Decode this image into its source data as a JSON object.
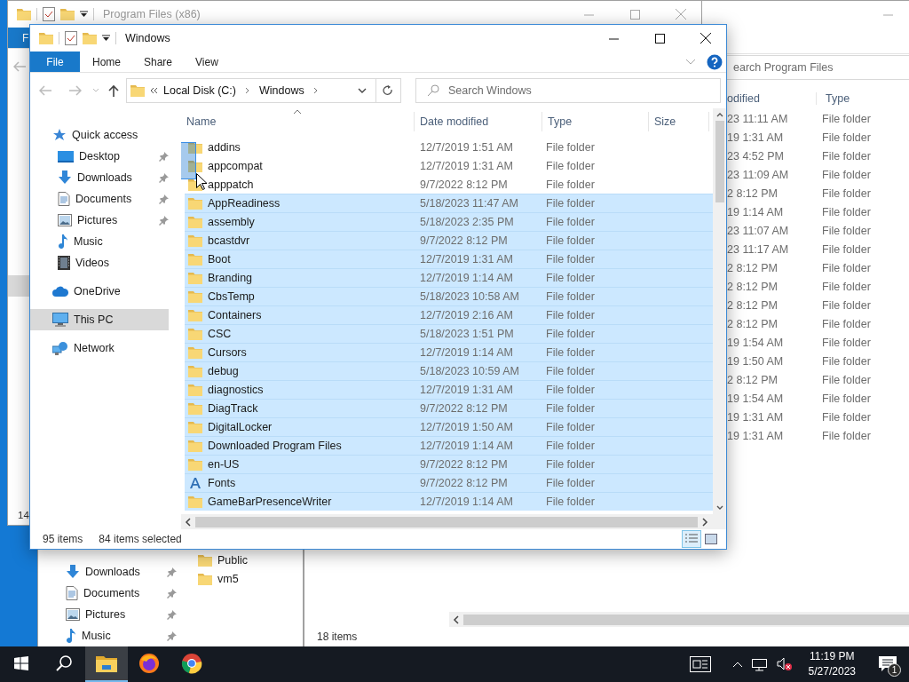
{
  "back_window_left": {
    "title": "Program Files (x86)",
    "file_tab": "F",
    "status": "14"
  },
  "back_window_right": {
    "search_placeholder": "earch Program Files",
    "columns": [
      "odified",
      "Type"
    ],
    "rows": [
      {
        "date": "23 11:11 AM",
        "type": "File folder"
      },
      {
        "date": "19 1:31 AM",
        "type": "File folder"
      },
      {
        "date": "23 4:52 PM",
        "type": "File folder"
      },
      {
        "date": "23 11:09 AM",
        "type": "File folder"
      },
      {
        "date": "2 8:12 PM",
        "type": "File folder"
      },
      {
        "date": "19 1:14 AM",
        "type": "File folder"
      },
      {
        "date": "23 11:07 AM",
        "type": "File folder"
      },
      {
        "date": "23 11:17 AM",
        "type": "File folder"
      },
      {
        "date": "2 8:12 PM",
        "type": "File folder"
      },
      {
        "date": "2 8:12 PM",
        "type": "File folder"
      },
      {
        "date": "2 8:12 PM",
        "type": "File folder"
      },
      {
        "date": "2 8:12 PM",
        "type": "File folder"
      },
      {
        "date": "19 1:54 AM",
        "type": "File folder"
      },
      {
        "date": "19 1:50 AM",
        "type": "File folder"
      },
      {
        "date": "2 8:12 PM",
        "type": "File folder"
      },
      {
        "date": "19 1:54 AM",
        "type": "File folder"
      },
      {
        "date": "19 1:31 AM",
        "type": "File folder"
      },
      {
        "date": "19 1:31 AM",
        "type": "File folder"
      }
    ],
    "status": "18 items"
  },
  "back_window_lower": {
    "nav_items": [
      {
        "label": "Downloads",
        "kind": "downloads"
      },
      {
        "label": "Documents",
        "kind": "documents"
      },
      {
        "label": "Pictures",
        "kind": "pictures"
      },
      {
        "label": "Music",
        "kind": "music"
      }
    ],
    "files": [
      "Public",
      "vm5"
    ]
  },
  "window": {
    "title": "Windows",
    "ribbon_tabs": [
      {
        "label": "File",
        "kind": "file"
      },
      {
        "label": "Home",
        "kind": "tab"
      },
      {
        "label": "Share",
        "kind": "tab"
      },
      {
        "label": "View",
        "kind": "tab"
      }
    ],
    "address": [
      "Local Disk (C:)",
      "Windows"
    ],
    "search": {
      "placeholder": "Search Windows"
    },
    "nav": [
      {
        "label": "Quick access",
        "kind": "star",
        "selected": false,
        "children": [
          {
            "label": "Desktop",
            "kind": "desktop",
            "selected": false,
            "pinned": true
          },
          {
            "label": "Downloads",
            "kind": "downloads",
            "selected": false,
            "pinned": true
          },
          {
            "label": "Documents",
            "kind": "documents",
            "selected": false,
            "pinned": true
          },
          {
            "label": "Pictures",
            "kind": "pictures",
            "selected": false,
            "pinned": true
          },
          {
            "label": "Music",
            "kind": "music",
            "selected": false,
            "pinned": false
          },
          {
            "label": "Videos",
            "kind": "videos",
            "selected": false,
            "pinned": false
          }
        ]
      },
      {
        "label": "OneDrive",
        "kind": "cloud",
        "selected": false
      },
      {
        "label": "This PC",
        "kind": "pc",
        "selected": true
      },
      {
        "label": "Network",
        "kind": "network",
        "selected": false
      }
    ],
    "columns": [
      {
        "label": "Name",
        "sorted": true
      },
      {
        "label": "Date modified",
        "sorted": false
      },
      {
        "label": "Type",
        "sorted": false
      },
      {
        "label": "Size",
        "sorted": false
      }
    ],
    "rows": [
      {
        "name": "addins",
        "date": "12/7/2019 1:51 AM",
        "type": "File folder",
        "kind": "folder",
        "selected": false
      },
      {
        "name": "appcompat",
        "date": "12/7/2019 1:31 AM",
        "type": "File folder",
        "kind": "folder",
        "selected": false
      },
      {
        "name": "apppatch",
        "date": "9/7/2022 8:12 PM",
        "type": "File folder",
        "kind": "folder",
        "selected": false
      },
      {
        "name": "AppReadiness",
        "date": "5/18/2023 11:47 AM",
        "type": "File folder",
        "kind": "folder",
        "selected": true
      },
      {
        "name": "assembly",
        "date": "5/18/2023 2:35 PM",
        "type": "File folder",
        "kind": "folder",
        "selected": true
      },
      {
        "name": "bcastdvr",
        "date": "9/7/2022 8:12 PM",
        "type": "File folder",
        "kind": "folder",
        "selected": true
      },
      {
        "name": "Boot",
        "date": "12/7/2019 1:31 AM",
        "type": "File folder",
        "kind": "folder",
        "selected": true
      },
      {
        "name": "Branding",
        "date": "12/7/2019 1:14 AM",
        "type": "File folder",
        "kind": "folder",
        "selected": true
      },
      {
        "name": "CbsTemp",
        "date": "5/18/2023 10:58 AM",
        "type": "File folder",
        "kind": "folder",
        "selected": true
      },
      {
        "name": "Containers",
        "date": "12/7/2019 2:16 AM",
        "type": "File folder",
        "kind": "folder",
        "selected": true
      },
      {
        "name": "CSC",
        "date": "5/18/2023 1:51 PM",
        "type": "File folder",
        "kind": "folder",
        "selected": true
      },
      {
        "name": "Cursors",
        "date": "12/7/2019 1:14 AM",
        "type": "File folder",
        "kind": "folder",
        "selected": true
      },
      {
        "name": "debug",
        "date": "5/18/2023 10:59 AM",
        "type": "File folder",
        "kind": "folder",
        "selected": true
      },
      {
        "name": "diagnostics",
        "date": "12/7/2019 1:31 AM",
        "type": "File folder",
        "kind": "folder",
        "selected": true
      },
      {
        "name": "DiagTrack",
        "date": "9/7/2022 8:12 PM",
        "type": "File folder",
        "kind": "folder",
        "selected": true
      },
      {
        "name": "DigitalLocker",
        "date": "12/7/2019 1:50 AM",
        "type": "File folder",
        "kind": "folder",
        "selected": true
      },
      {
        "name": "Downloaded Program Files",
        "date": "12/7/2019 1:14 AM",
        "type": "File folder",
        "kind": "folder",
        "selected": true
      },
      {
        "name": "en-US",
        "date": "9/7/2022 8:12 PM",
        "type": "File folder",
        "kind": "folder",
        "selected": true
      },
      {
        "name": "Fonts",
        "date": "9/7/2022 8:12 PM",
        "type": "File folder",
        "kind": "fonts",
        "selected": true
      },
      {
        "name": "GameBarPresenceWriter",
        "date": "12/7/2019 1:14 AM",
        "type": "File folder",
        "kind": "folder",
        "selected": true
      }
    ],
    "status": {
      "count": "95 items",
      "selected": "84 items selected"
    }
  },
  "taskbar": {
    "apps": [
      {
        "kind": "search",
        "active": false
      },
      {
        "kind": "explorer",
        "active": true
      },
      {
        "kind": "firefox",
        "active": false
      },
      {
        "kind": "chrome",
        "active": false
      }
    ],
    "time": "11:19 PM",
    "date": "5/27/2023",
    "notifications": "1"
  }
}
